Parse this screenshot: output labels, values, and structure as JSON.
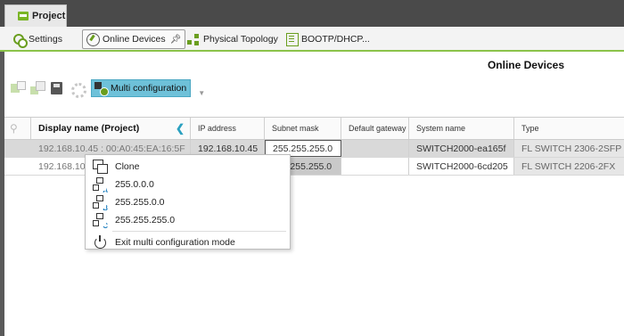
{
  "project_tab": {
    "label": "Project"
  },
  "tabs": [
    {
      "label": "Settings",
      "icon": "settings-icon"
    },
    {
      "label": "Online Devices",
      "icon": "online-devices-icon",
      "active": true,
      "pinned": true
    },
    {
      "label": "Physical Topology",
      "icon": "topology-icon"
    },
    {
      "label": "BOOTP/DHCP...",
      "icon": "bootp-icon"
    }
  ],
  "page_heading": "Online Devices",
  "toolbar": {
    "multi_config_label": "Multi configuration"
  },
  "table": {
    "headers": [
      "Display name (Project)",
      "IP address",
      "Subnet mask",
      "Default gateway",
      "System name",
      "Type"
    ],
    "rows": [
      {
        "display_name": "192.168.10.45 : 00:A0:45:EA:16:5F",
        "ip": "192.168.10.45",
        "subnet": "255.255.255.0",
        "gateway": "",
        "system_name": "SWITCH2000-ea165f",
        "type": "FL SWITCH 2306-2SFP"
      },
      {
        "display_name": "192.168.10.",
        "ip": "",
        "subnet": "255.255.255.0",
        "gateway": "",
        "system_name": "SWITCH2000-6cd205",
        "type": "FL SWITCH 2206-2FX"
      }
    ]
  },
  "context_menu": {
    "items": [
      {
        "label": "Clone",
        "icon": "clone-icon"
      },
      {
        "label": "255.0.0.0",
        "icon": "network-class-a-icon",
        "letter": "A"
      },
      {
        "label": "255.255.0.0",
        "icon": "network-class-b-icon",
        "letter": "B"
      },
      {
        "label": "255.255.255.0",
        "icon": "network-class-c-icon",
        "letter": "C"
      }
    ],
    "exit_label": "Exit multi configuration mode"
  },
  "colors": {
    "accent_green": "#8bc34a",
    "multi_config_blue": "#6ec1d9",
    "header_arrow": "#2aa0c0",
    "topbar": "#4a4a4a"
  }
}
